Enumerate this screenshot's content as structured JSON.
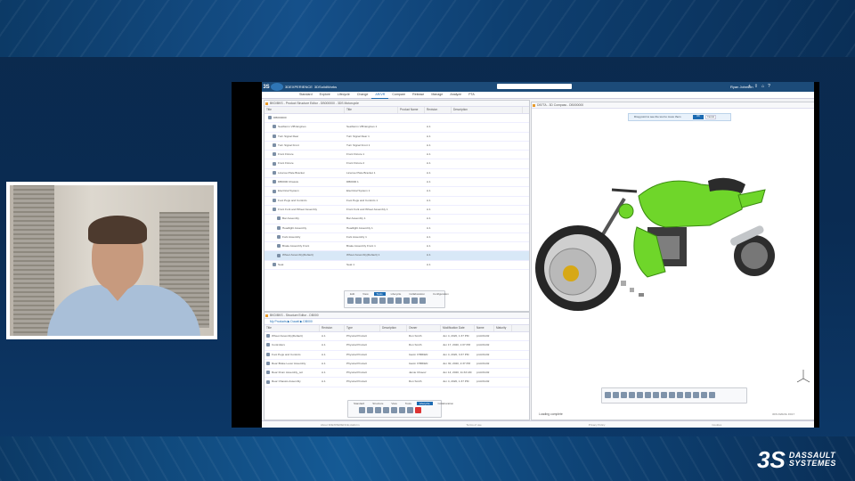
{
  "logo": {
    "mark": "3S",
    "line1": "DASSAULT",
    "line2": "SYSTEMES"
  },
  "app": {
    "brand": "3DEXPERIENCE",
    "workspace": "3DSolidWorks",
    "user": "Ryan Johnson",
    "tabs": [
      "Standard",
      "Explore",
      "Lifecycle",
      "Change",
      "AR/VR",
      "Compare",
      "Release",
      "Manage",
      "Analyze",
      "PTA"
    ],
    "active_tab": "AR/VR",
    "footer": [
      "About 3DEXPERIENCE platform",
      "Terms of use",
      "Privacy Policy",
      "Cookies"
    ]
  },
  "tree_panel": {
    "title": "BKD/BKS - Product Structure Editor - DB000000 - 3DS Motorcycle",
    "columns": [
      "Title",
      "Title",
      "Product Name",
      "Revision",
      "Description"
    ],
    "rows": [
      {
        "title": "DB000000",
        "title2": "",
        "rev": "",
        "indent": 0
      },
      {
        "title": "SeaStorm VIB Engines",
        "title2": "SeaStorm VIB Engines 1",
        "rev": "A.1",
        "indent": 1
      },
      {
        "title": "Turn Signal Rear",
        "title2": "Turn Signal Rear 1",
        "rev": "A.1",
        "indent": 1
      },
      {
        "title": "Turn Signal Front",
        "title2": "Turn Signal Front 1",
        "rev": "A.1",
        "indent": 1
      },
      {
        "title": "Front Fixture",
        "title2": "Front Fixture 1",
        "rev": "A.1",
        "indent": 1
      },
      {
        "title": "Front Fixture",
        "title2": "Front Fixture 2",
        "rev": "A.1",
        "indent": 1
      },
      {
        "title": "License Plate Bracket",
        "title2": "License Plate Bracket 1",
        "rev": "A.1",
        "indent": 1
      },
      {
        "title": "DB0000 Chassis",
        "title2": "DB0000 1",
        "rev": "A.1",
        "indent": 1
      },
      {
        "title": "Electrical System",
        "title2": "Electrical System 1",
        "rev": "A.1",
        "indent": 1
      },
      {
        "title": "Foot Pegs and Controls",
        "title2": "Foot Pegs and Controls 1",
        "rev": "A.1",
        "indent": 1
      },
      {
        "title": "Front Fork and Wheel Assembly",
        "title2": "Front Fork and Wheel Assembly 1",
        "rev": "A.1",
        "indent": 1
      },
      {
        "title": "Bar Assembly",
        "title2": "Bar Assembly 1",
        "rev": "A.1",
        "indent": 2
      },
      {
        "title": "Headlight Assembly",
        "title2": "Headlight Assembly 1",
        "rev": "A.1",
        "indent": 2
      },
      {
        "title": "Fork Assembly",
        "title2": "Fork Assembly 1",
        "rev": "A.1",
        "indent": 2
      },
      {
        "title": "Brake Assembly Front",
        "title2": "Brake Assembly Front 1",
        "rev": "A.1",
        "indent": 2
      },
      {
        "title": "Wheel Assembly(Default)",
        "title2": "Wheel Assembly(Default) 1",
        "rev": "A.1",
        "indent": 2,
        "selected": true
      },
      {
        "title": "Seat",
        "title2": "Seat 1",
        "rev": "A.1",
        "indent": 1
      }
    ]
  },
  "toolbar1": {
    "labels": [
      "Edit",
      "View",
      "Tools",
      "Lifecycle",
      "Collaboration",
      "Configuration"
    ],
    "active": "Tools"
  },
  "content_panel": {
    "title": "BKD/BKS - Structure Editor - DB000",
    "breadcrumb": "My Products ▶ Ducati ▶ DB000",
    "columns": [
      "Title",
      "Revision",
      "Type",
      "Description",
      "Owner",
      "Modification Date",
      "Name",
      "Maturity"
    ],
    "rows": [
      {
        "title": "Wheel Assembly(Default)",
        "rev": "A.1",
        "type": "Physical Product",
        "owner": "Ron Smith",
        "date": "Jun 4, 2020, 1:37 PM",
        "name": "prd-R1132"
      },
      {
        "title": "Controllers",
        "rev": "A.1",
        "type": "Physical Product",
        "owner": "Ron Smith",
        "date": "Jun 17, 2020, 1:07 PM",
        "name": "prd-R1132"
      },
      {
        "title": "Foot Pegs and Controls",
        "rev": "A.1",
        "type": "Physical Product",
        "owner": "Gavin O'BRIEN",
        "date": "Jun 4, 2020, 3:37 PM",
        "name": "prd-R1132"
      },
      {
        "title": "Rear Brake Lever Assembly",
        "rev": "A.1",
        "type": "Physical Product",
        "owner": "Gavin O'BRIEN",
        "date": "Jun 30, 2020, 2:37 PM",
        "name": "prd-R1132"
      },
      {
        "title": "Rear Drum Assembly_sol",
        "rev": "A.1",
        "type": "Physical Product",
        "owner": "Jamie Chavez",
        "date": "Jun 14, 2020, 11:33 AM",
        "name": "prd-R1132"
      },
      {
        "title": "Rear Chassis Assembly",
        "rev": "A.1",
        "type": "Physical Product",
        "owner": "Ron Smith",
        "date": "Jun 4, 2020, 1:37 PM",
        "name": "prd-R1132"
      }
    ]
  },
  "toolbar2": {
    "labels": [
      "Standard",
      "Structure",
      "View",
      "Tools",
      "Lifecycle",
      "Collaboration"
    ],
    "active": "Lifecycle"
  },
  "viewer": {
    "title": "DB7TA - 3D Compass - DB000000",
    "hint": "Drag point to see the tool to move them",
    "ok": "OK",
    "cancel": "Cancel",
    "status": "Loading complete",
    "id": "3DS R2020x FD17"
  },
  "colors": {
    "accent": "#1c6bb2",
    "bike_green": "#6fd62a",
    "topbar": "#1c4b79"
  }
}
